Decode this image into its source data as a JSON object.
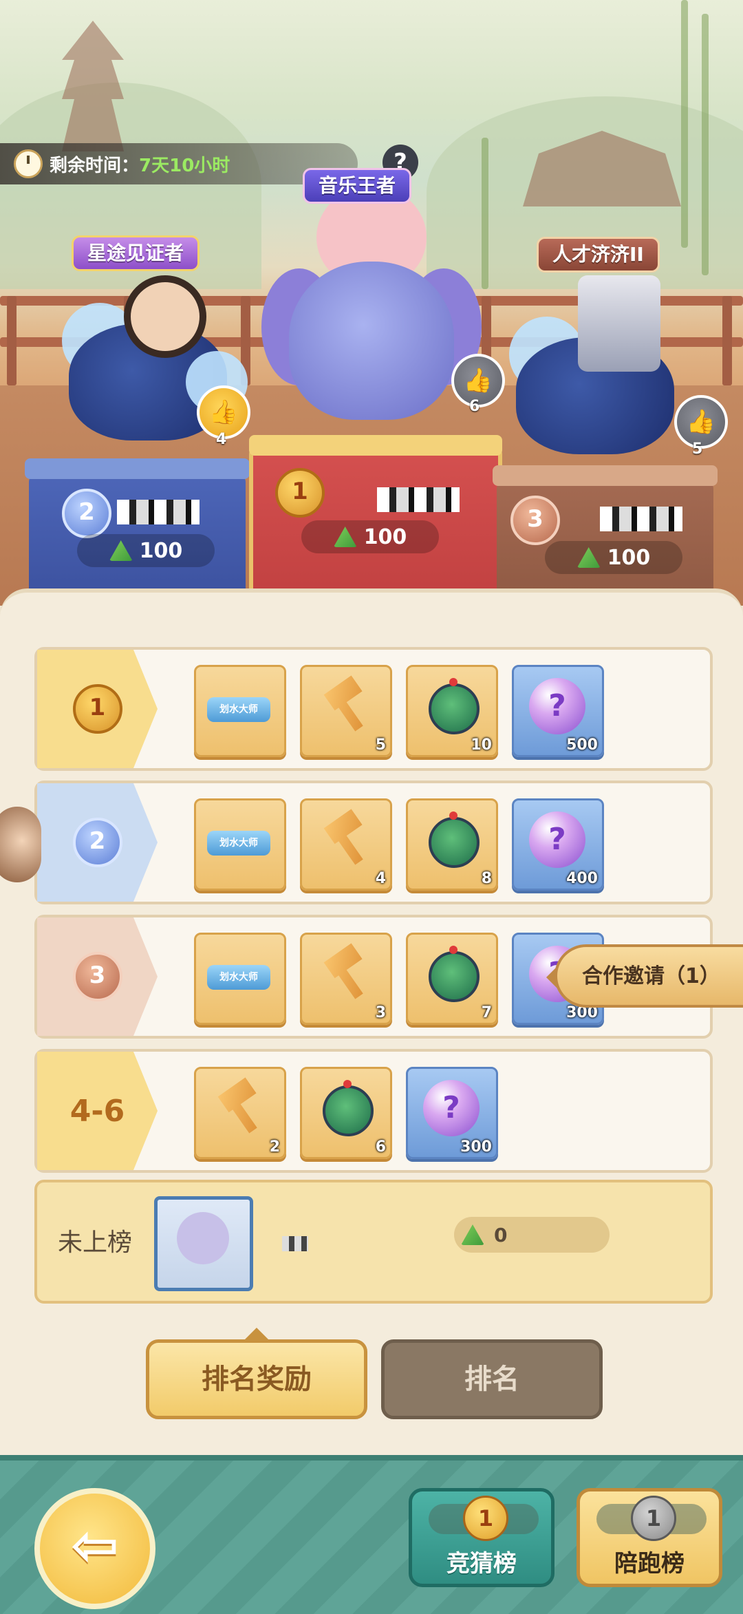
{
  "header": {
    "time_label": "剩余时间：",
    "time_value": "7天10小时",
    "help_icon": "?"
  },
  "podium": {
    "first": {
      "rank": "1",
      "title": "音乐王者",
      "likes": "6",
      "score": "100"
    },
    "second": {
      "rank": "2",
      "title": "星途见证者",
      "likes": "4",
      "score": "100"
    },
    "third": {
      "rank": "3",
      "title": "人才济济II",
      "likes": "5",
      "score": "100"
    }
  },
  "rewards": [
    {
      "rank": "1",
      "items": [
        {
          "icon": "title-card",
          "label": "划水大师",
          "qty": ""
        },
        {
          "icon": "hammer-icon",
          "qty": "5"
        },
        {
          "icon": "spinning-top-icon",
          "qty": "10"
        },
        {
          "icon": "mystery-orb-icon",
          "qty": "500"
        }
      ]
    },
    {
      "rank": "2",
      "items": [
        {
          "icon": "title-card",
          "label": "划水大师",
          "qty": ""
        },
        {
          "icon": "hammer-icon",
          "qty": "4"
        },
        {
          "icon": "spinning-top-icon",
          "qty": "8"
        },
        {
          "icon": "mystery-orb-icon",
          "qty": "400"
        }
      ]
    },
    {
      "rank": "3",
      "items": [
        {
          "icon": "title-card",
          "label": "划水大师",
          "qty": ""
        },
        {
          "icon": "hammer-icon",
          "qty": "3"
        },
        {
          "icon": "spinning-top-icon",
          "qty": "7"
        },
        {
          "icon": "mystery-orb-icon",
          "qty": "300"
        }
      ]
    },
    {
      "rank": "4-6",
      "items": [
        {
          "icon": "hammer-icon",
          "qty": "2"
        },
        {
          "icon": "spinning-top-icon",
          "qty": "6"
        },
        {
          "icon": "mystery-orb-icon",
          "qty": "300"
        }
      ]
    }
  ],
  "not_ranked": {
    "label": "未上榜",
    "score": "0"
  },
  "tabs": {
    "reward": "排名奖励",
    "ranking": "排名"
  },
  "coop_invite": "合作邀请（1）",
  "bottom_nav": {
    "back_icon": "arrow-left-icon",
    "guess_label": "竞猜榜",
    "guess_rank": "1",
    "run_label": "陪跑榜",
    "run_rank": "1"
  },
  "colors": {
    "accent_gold": "#f2cb6a",
    "panel_bg": "#f4ecdc",
    "nav_teal": "#5fa497"
  }
}
